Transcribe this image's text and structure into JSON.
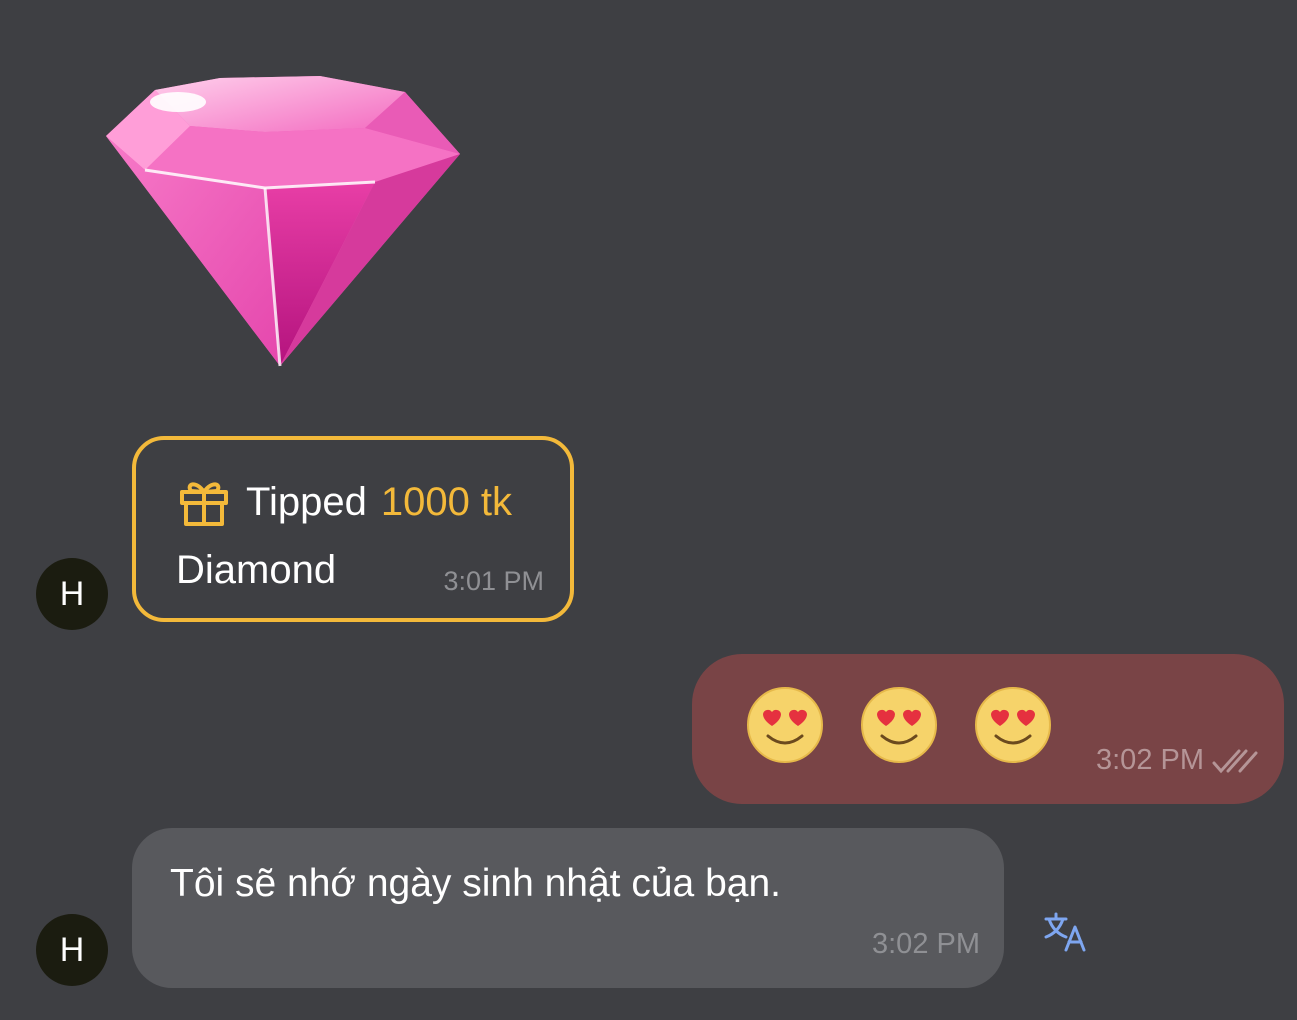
{
  "messages": {
    "tip": {
      "avatar_initial": "H",
      "tipped_label": "Tipped",
      "amount": "1000 tk",
      "gift_name": "Diamond",
      "time": "3:01 PM",
      "gift_icon": "gift-icon",
      "accent_color": "#f3b93a"
    },
    "outgoing": {
      "emojis": [
        "smiling-face-with-heart-eyes",
        "smiling-face-with-heart-eyes",
        "smiling-face-with-heart-eyes"
      ],
      "time": "3:02 PM",
      "status_icon": "double-check-icon",
      "bubble_color": "#794446"
    },
    "incoming": {
      "avatar_initial": "H",
      "text": "Tôi sẽ nhớ ngày sinh nhật của bạn.",
      "time": "3:02 PM",
      "action_icon": "translate-icon",
      "bubble_color": "#58595d"
    }
  }
}
